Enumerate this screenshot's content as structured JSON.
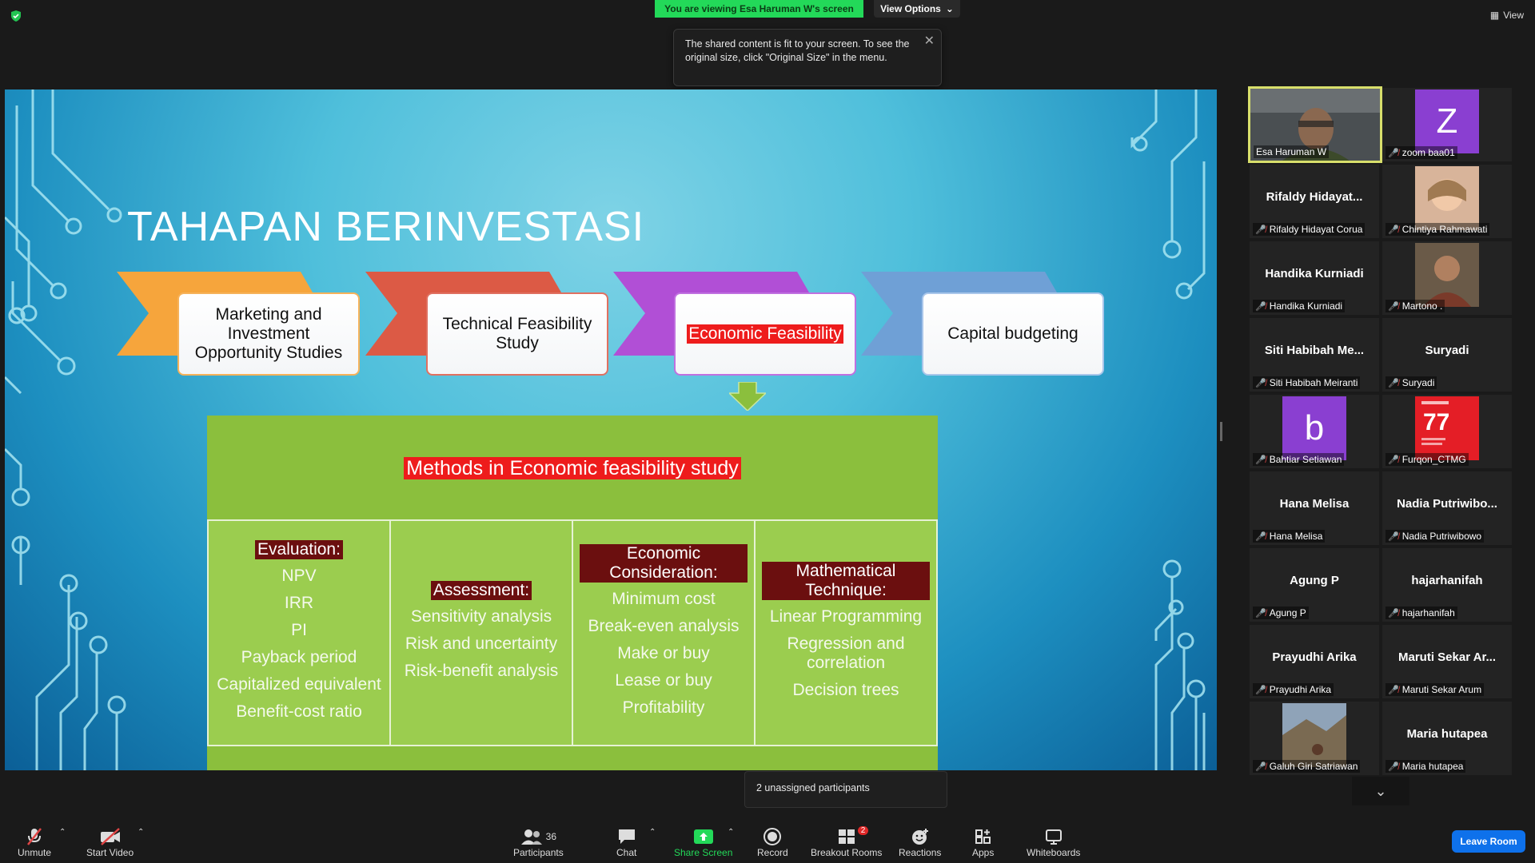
{
  "top": {
    "viewing_banner": "You are viewing Esa Haruman W's screen",
    "view_options": "View Options",
    "tooltip_text": "The shared content is fit to your screen. To see the original size, click \"Original Size\" in the menu.",
    "view": "View"
  },
  "slide": {
    "title": "TAHAPAN BERINVESTASI",
    "steps": [
      "Marketing and Investment Opportunity Studies",
      "Technical Feasibility Study",
      "Economic Feasibility",
      "Capital budgeting"
    ],
    "methods_title": "Methods in Economic feasibility study",
    "columns": [
      {
        "heading": "Evaluation:",
        "items": [
          "NPV",
          "IRR",
          "PI",
          "Payback period",
          "Capitalized equivalent",
          "Benefit-cost ratio"
        ]
      },
      {
        "heading": "Assessment:",
        "items": [
          "Sensitivity analysis",
          "Risk and uncertainty",
          "Risk-benefit analysis"
        ]
      },
      {
        "heading": "Economic Consideration:",
        "items": [
          "Minimum cost",
          "Break-even analysis",
          "Make or buy",
          "Lease or buy",
          "Profitability"
        ]
      },
      {
        "heading": "Mathematical Technique:",
        "items": [
          "Linear Programming",
          "Regression and correlation",
          "Decision trees"
        ]
      }
    ]
  },
  "participants": [
    {
      "name": "Esa Haruman W"
    },
    {
      "name": "zoom baa01",
      "initial": "Z"
    },
    {
      "name": "Rifaldy Hidayat Corua",
      "display": "Rifaldy  Hidayat..."
    },
    {
      "name": "Chintiya Rahmawati"
    },
    {
      "name": "Handika Kurniadi",
      "display": "Handika Kurniadi"
    },
    {
      "name": "Martono ."
    },
    {
      "name": "Siti Habibah Meiranti",
      "display": "Siti  Habibah  Me..."
    },
    {
      "name": "Suryadi",
      "display": "Suryadi"
    },
    {
      "name": "Bahtiar Setiawan",
      "initial": "b"
    },
    {
      "name": "Furqon_CTMG"
    },
    {
      "name": "Hana Melisa",
      "display": "Hana Melisa"
    },
    {
      "name": "Nadia Putriwibowo",
      "display": "Nadia  Putriwibo..."
    },
    {
      "name": "Agung P",
      "display": "Agung P"
    },
    {
      "name": "hajarhanifah",
      "display": "hajarhanifah"
    },
    {
      "name": "Prayudhi Arika",
      "display": "Prayudhi Arika"
    },
    {
      "name": "Maruti Sekar Arum",
      "display": "Maruti  Sekar  Ar..."
    },
    {
      "name": "Galuh Giri Satriawan"
    },
    {
      "name": "Maria hutapea",
      "display": "Maria hutapea"
    }
  ],
  "popup": {
    "unassigned": "2 unassigned participants"
  },
  "toolbar": {
    "unmute": "Unmute",
    "start_video": "Start Video",
    "participants": "Participants",
    "participants_count": "36",
    "chat": "Chat",
    "share_screen": "Share Screen",
    "record": "Record",
    "breakout_rooms": "Breakout Rooms",
    "breakout_badge": "2",
    "reactions": "Reactions",
    "apps": "Apps",
    "whiteboards": "Whiteboards",
    "leave_room": "Leave Room"
  }
}
